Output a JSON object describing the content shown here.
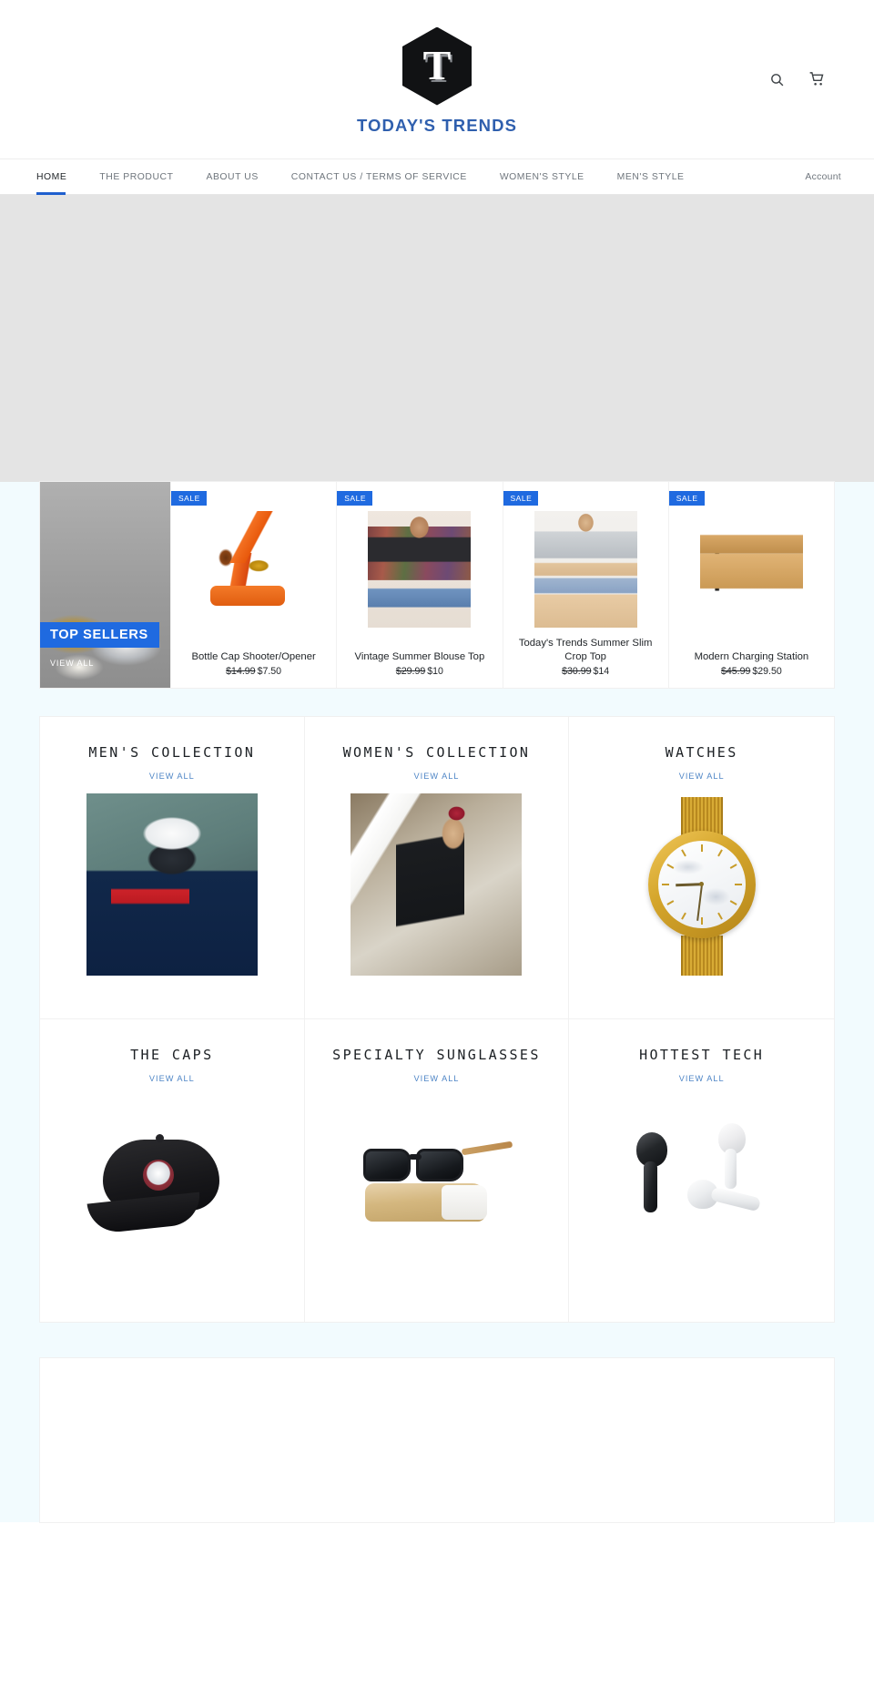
{
  "header": {
    "logo_letter": "T",
    "brand_name": "TODAY'S TRENDS",
    "search_icon": "search-icon",
    "cart_icon": "cart-icon"
  },
  "nav": {
    "items": [
      {
        "label": "HOME",
        "active": true
      },
      {
        "label": "THE PRODUCT",
        "active": false
      },
      {
        "label": "ABOUT US",
        "active": false
      },
      {
        "label": "CONTACT US / TERMS OF SERVICE",
        "active": false
      },
      {
        "label": "WOMEN'S STYLE",
        "active": false
      },
      {
        "label": "MEN'S STYLE",
        "active": false
      }
    ],
    "account_label": "Account"
  },
  "top_sellers": {
    "promo_label": "TOP SELLERS",
    "promo_view_all": "VIEW ALL",
    "sale_badge": "SALE",
    "products": [
      {
        "title": "Bottle Cap Shooter/Opener",
        "price_old": "$14.99",
        "price_new": "$7.50",
        "badge": "SALE",
        "art": "art-opener"
      },
      {
        "title": "Vintage Summer Blouse Top",
        "price_old": "$29.99",
        "price_new": "$10",
        "badge": "SALE",
        "art": "art-blouse"
      },
      {
        "title": "Today's Trends Summer Slim Crop Top",
        "price_old": "$30.99",
        "price_new": "$14",
        "badge": "SALE",
        "art": "art-crop"
      },
      {
        "title": "Modern Charging Station",
        "price_old": "$45.99",
        "price_new": "$29.50",
        "badge": "SALE",
        "art": "art-charger"
      }
    ]
  },
  "collections": {
    "view_all_label": "VIEW ALL",
    "items": [
      {
        "title": "MEN'S COLLECTION",
        "view_all": "VIEW ALL"
      },
      {
        "title": "WOMEN'S COLLECTION",
        "view_all": "VIEW ALL"
      },
      {
        "title": "WATCHES",
        "view_all": "VIEW ALL"
      },
      {
        "title": "THE CAPS",
        "view_all": "VIEW ALL"
      },
      {
        "title": "SPECIALTY SUNGLASSES",
        "view_all": "VIEW ALL"
      },
      {
        "title": "HOTTEST TECH",
        "view_all": "VIEW ALL"
      }
    ]
  },
  "colors": {
    "accent_blue": "#1f6ae0",
    "brand_blue": "#2f5fae",
    "link_blue": "#4f86c6",
    "page_bg": "#f2fbfe",
    "hero_bg": "#e4e4e4"
  }
}
